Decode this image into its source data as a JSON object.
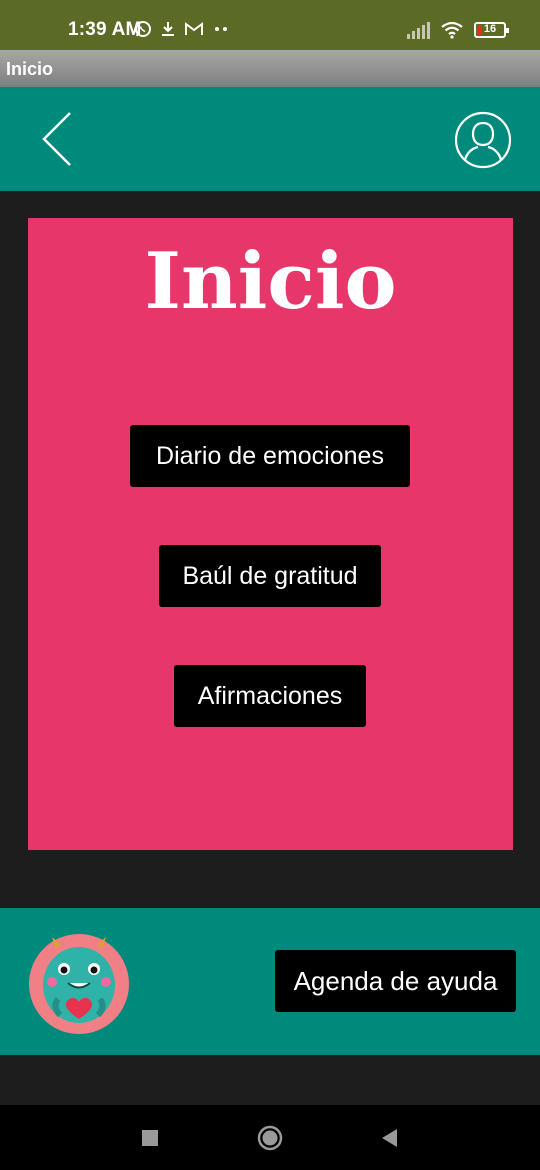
{
  "status_bar": {
    "time": "1:39 AM",
    "battery_level": "16",
    "icons": [
      "whatsapp-icon",
      "download-icon",
      "gmail-icon",
      "more-dots-icon",
      "signal-icon",
      "wifi-icon",
      "battery-icon"
    ]
  },
  "window": {
    "title": "Inicio"
  },
  "header": {
    "icons": [
      "back-arrow-icon",
      "user-profile-icon"
    ]
  },
  "main": {
    "title": "Inicio",
    "buttons": [
      {
        "label": "Diario de emociones"
      },
      {
        "label": "Baúl de gratitud"
      },
      {
        "label": "Afirmaciones"
      }
    ]
  },
  "footer": {
    "avatar_icon": "teal-monster-heart-icon",
    "help_button_label": "Agenda de ayuda"
  },
  "nav_bar": {
    "icons": [
      "recents-square-icon",
      "home-circle-icon",
      "back-triangle-icon"
    ]
  },
  "colors": {
    "status_bar": "#5b6a24",
    "header_teal": "#008a7b",
    "card_pink": "#e6366a",
    "button_black": "#000000",
    "background": "#1d1d1d"
  }
}
